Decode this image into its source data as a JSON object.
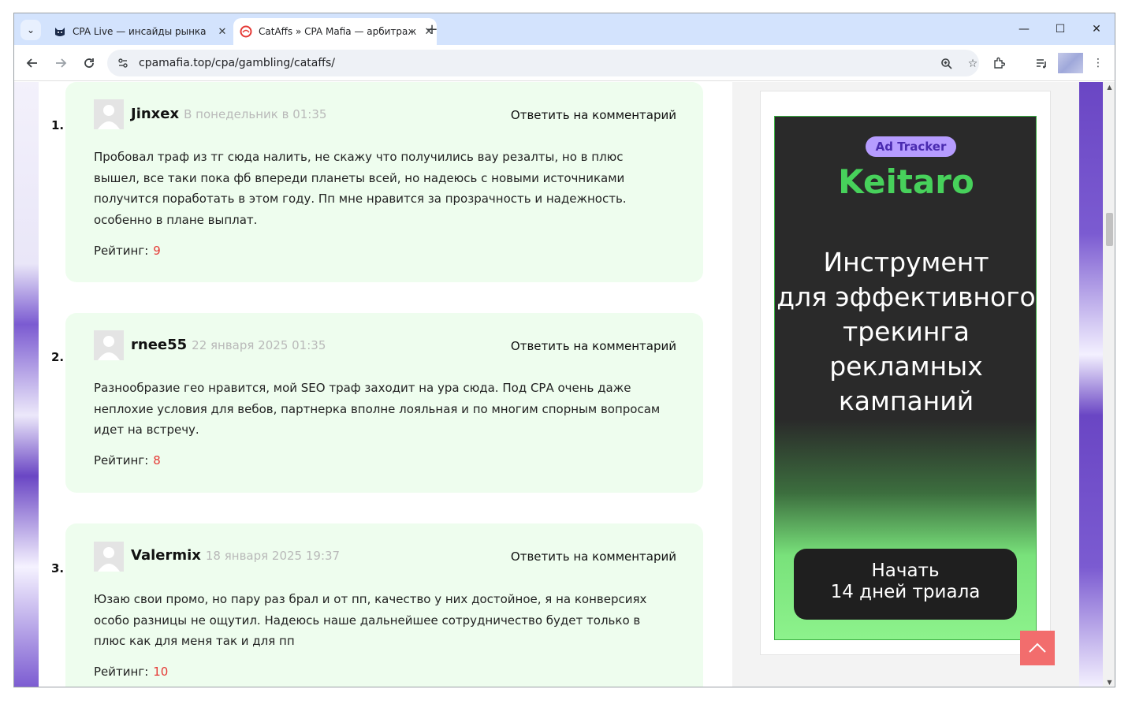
{
  "browser": {
    "tabs": [
      {
        "title": "CPA Live — инсайды рынка",
        "favicon": "cat-icon",
        "active": false
      },
      {
        "title": "CatAffs » CPA Mafia — арбитраж",
        "favicon": "catAffs-icon",
        "active": true
      }
    ],
    "url": "cpamafia.top/cpa/gambling/cataffs/"
  },
  "comments": [
    {
      "number": "1.",
      "author": "Jinxex",
      "date": "В понедельник в 01:35",
      "reply_label": "Ответить на комментарий",
      "text": "Пробовал траф из тг сюда налить, не скажу что получились вау резалты, но в плюс вышел, все таки пока фб впереди планеты всей, но надеюсь с новыми источниками получится поработать в этом году. Пп мне нравится за прозрачность и надежность. особенно в плане выплат.",
      "rating_label": "Рейтинг:",
      "rating": "9"
    },
    {
      "number": "2.",
      "author": "rnee55",
      "date": "22 января 2025 01:35",
      "reply_label": "Ответить на комментарий",
      "text": "Разнообразие гео нравится, мой SEO траф заходит на ура сюда. Под СРА очень даже неплохие условия для вебов, партнерка вполне лояльная и по многим спорным вопросам идет на встречу.",
      "rating_label": "Рейтинг:",
      "rating": "8"
    },
    {
      "number": "3.",
      "author": "Valermix",
      "date": "18 января 2025 19:37",
      "reply_label": "Ответить на комментарий",
      "text": "Юзаю свои промо, но пару раз брал и от пп, качество у них достойное, я на конверсиях особо разницы не ощутил. Надеюсь наше дальнейшее сотрудничество будет только в плюс как для меня так и для пп",
      "rating_label": "Рейтинг:",
      "rating": "10"
    }
  ],
  "ad": {
    "badge": "Ad Tracker",
    "brand": "Keitaro",
    "headline_lines": [
      "Инструмент",
      "для эффективного",
      "трекинга",
      "рекламных",
      "кампаний"
    ],
    "button_lines": [
      "Начать",
      "14 дней триала"
    ]
  },
  "colors": {
    "comment_bg": "#eefdee",
    "rating_value": "#e53935",
    "ad_brand": "#47d15b",
    "ad_badge": "#b69cff",
    "to_top": "#f26d6d"
  }
}
